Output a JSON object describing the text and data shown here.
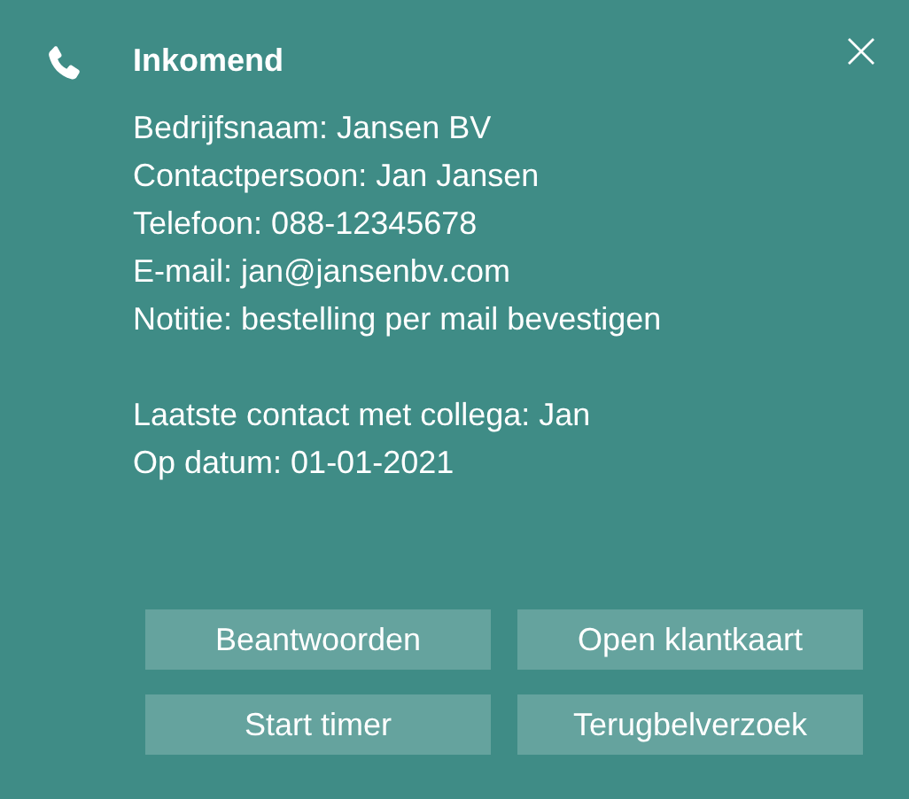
{
  "notification": {
    "title": "Inkomend",
    "details": [
      "Bedrijfsnaam: Jansen BV",
      "Contactpersoon: Jan Jansen",
      "Telefoon: 088-12345678",
      "E-mail: jan@jansenbv.com",
      "Notitie: bestelling per mail bevestigen"
    ],
    "history": [
      "Laatste contact met collega: Jan",
      "Op datum: 01-01-2021"
    ],
    "buttons": [
      "Beantwoorden",
      "Open klantkaart",
      "Start timer",
      "Terugbelverzoek"
    ]
  }
}
